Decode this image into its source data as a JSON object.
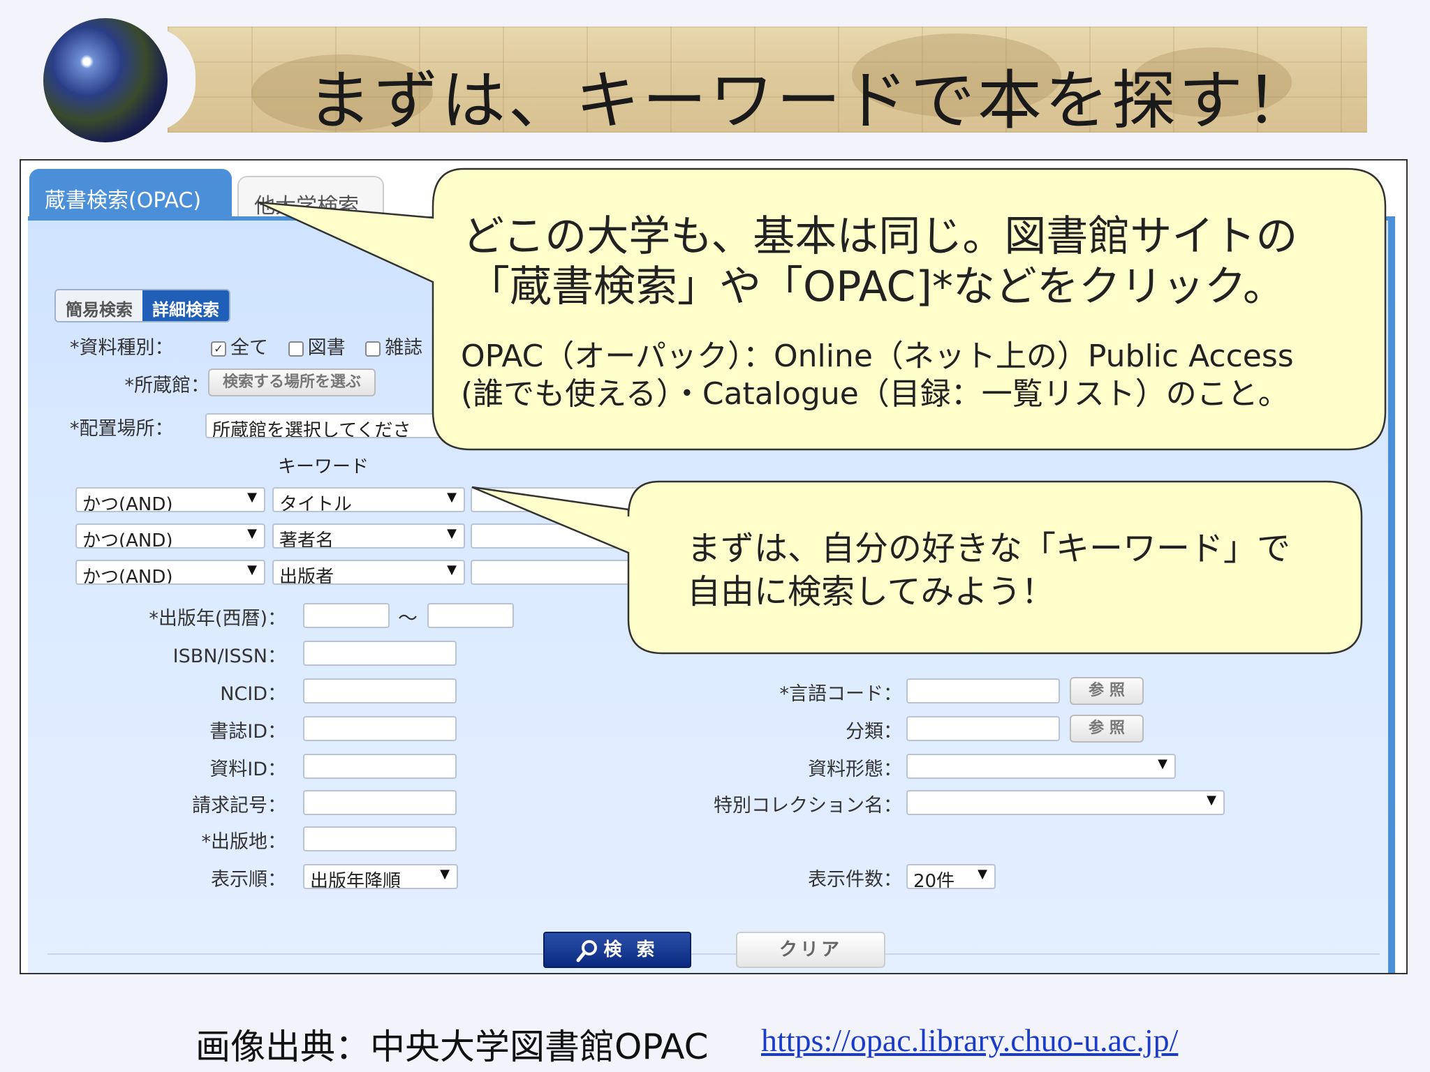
{
  "slide": {
    "title": "まずは、キーワードで本を探す！",
    "source_label": "画像出典：中央大学図書館OPAC",
    "source_url": "https://opac.library.chuo-u.ac.jp/"
  },
  "tabs": {
    "opac": "蔵書検索(OPAC)",
    "other": "他大学検索"
  },
  "modes": {
    "simple": "簡易検索",
    "detail": "詳細検索"
  },
  "form": {
    "type_label": "*資料種別：",
    "type_all": "全て",
    "type_book": "図書",
    "type_journal": "雑誌",
    "holding_label": "*所蔵館：",
    "holding_button": "検索する場所を選ぶ",
    "location_label": "*配置場所：",
    "location_value": "所蔵館を選択してくださ",
    "keyword_header": "キーワード",
    "rows": [
      {
        "op": "かつ(AND)",
        "field": "タイトル"
      },
      {
        "op": "かつ(AND)",
        "field": "著者名"
      },
      {
        "op": "かつ(AND)",
        "field": "出版者"
      }
    ],
    "year_label": "*出版年(西暦)：",
    "year_sep": "～",
    "isbn_label": "ISBN/ISSN：",
    "ncid_label": "NCID：",
    "bib_label": "書誌ID：",
    "item_label": "資料ID：",
    "call_label": "請求記号：",
    "place_label": "*出版地：",
    "order_label": "表示順：",
    "order_value": "出版年降順",
    "lang_label": "*言語コード：",
    "class_label": "分類：",
    "ref_button": "参 照",
    "format_label": "資料形態：",
    "collection_label": "特別コレクション名：",
    "count_label": "表示件数：",
    "count_value": "20件",
    "search_button": "検 索",
    "clear_button": "クリア"
  },
  "callouts": {
    "top_line1": "どこの大学も、基本は同じ。図書館サイトの",
    "top_line2": "「蔵書検索」や「OPAC]*などをクリック。",
    "top_line3": "OPAC（オーパック）：Online（ネット上の）Public Access",
    "top_line4": "(誰でも使える）・Catalogue（目録：一覧リスト）のこと。",
    "mid_line1": "まずは、自分の好きな「キーワード」で",
    "mid_line2": "自由に検索してみよう！"
  },
  "colors": {
    "banner": "#dcc89a",
    "tab_active": "#4a8fd8",
    "panel": "#dbeaff",
    "callout_fill": "#ffffcc",
    "search_button": "#0a2a80",
    "link": "#1a3cc8"
  },
  "icons": [
    "globe-icon",
    "magnifier-icon",
    "checkbox-checked-icon",
    "checkbox-empty-icon",
    "dropdown-arrow-icon"
  ]
}
